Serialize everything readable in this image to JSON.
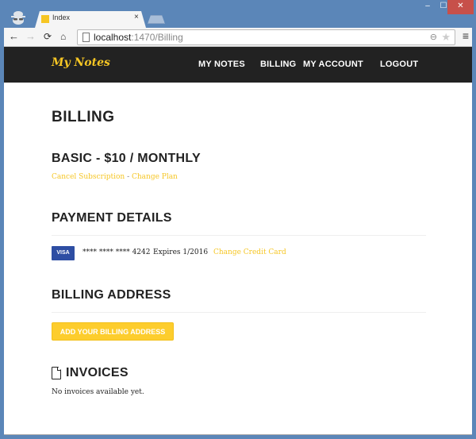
{
  "browser": {
    "tab_title": "Index",
    "tab_close": "×",
    "url_host": "localhost",
    "url_path": ":1470/Billing",
    "window_controls": {
      "minimize": "–",
      "maximize": "☐",
      "close": "✕"
    },
    "icons": {
      "back": "←",
      "forward": "→",
      "reload": "⟳",
      "home": "⌂",
      "zoom": "⊖",
      "star": "★",
      "menu": "≡"
    }
  },
  "navbar": {
    "brand": "My Notes",
    "links": [
      "MY NOTES",
      "BILLING",
      "MY ACCOUNT",
      "LOGOUT"
    ],
    "brand_color": "#f6c624",
    "background": "#222222"
  },
  "page": {
    "title": "BILLING",
    "plan": {
      "title": "BASIC - $10 / MONTHLY",
      "cancel_link": "Cancel Subscription",
      "separator": " - ",
      "change_plan_link": "Change Plan"
    },
    "payment": {
      "title": "PAYMENT DETAILS",
      "card_brand": "VISA",
      "card_number": "**** **** **** 4242",
      "expires": "Expires 1/2016",
      "change_link": "Change Credit Card"
    },
    "address": {
      "title": "BILLING ADDRESS",
      "button": "ADD YOUR BILLING ADDRESS"
    },
    "invoices": {
      "title": "INVOICES",
      "empty_text": "No invoices available yet."
    },
    "accent_color": "#f6c624"
  }
}
